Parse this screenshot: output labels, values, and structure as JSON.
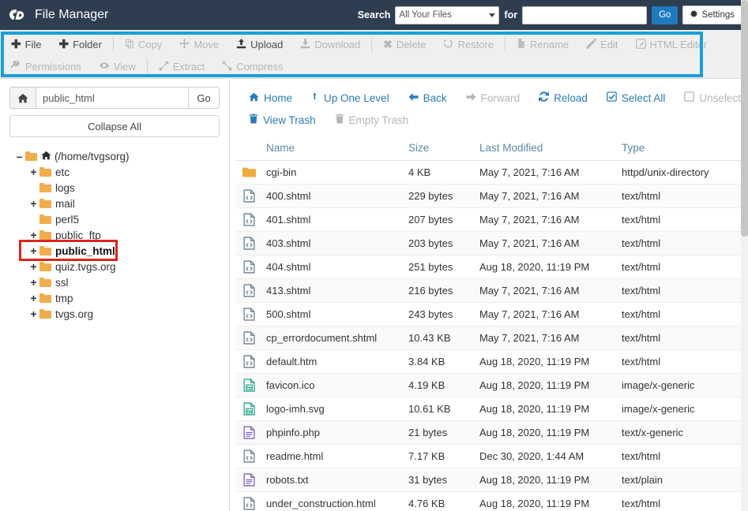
{
  "header": {
    "logo_text": "cP",
    "title": "File Manager",
    "search_label": "Search",
    "search_scope": "All Your Files",
    "for_label": "for",
    "search_value": "",
    "search_placeholder": "",
    "go_label": "Go",
    "settings_label": "Settings",
    "bg_color": "#2e3e50",
    "go_color": "#1e7bbf"
  },
  "toolbar": {
    "highlight_color": "#1a9fda",
    "row1": [
      {
        "label": "File",
        "icon": "plus-icon",
        "disabled": false
      },
      {
        "label": "Folder",
        "icon": "plus-icon",
        "disabled": false
      },
      {
        "label": "Copy",
        "icon": "copy-icon",
        "disabled": true
      },
      {
        "label": "Move",
        "icon": "move-icon",
        "disabled": true
      },
      {
        "label": "Upload",
        "icon": "upload-icon",
        "disabled": false
      },
      {
        "label": "Download",
        "icon": "download-icon",
        "disabled": true
      },
      {
        "label": "Delete",
        "icon": "delete-x-icon",
        "disabled": true
      },
      {
        "label": "Restore",
        "icon": "restore-icon",
        "disabled": true
      },
      {
        "label": "Rename",
        "icon": "rename-icon",
        "disabled": true
      },
      {
        "label": "Edit",
        "icon": "pencil-icon",
        "disabled": true
      },
      {
        "label": "HTML Editor",
        "icon": "html-editor-icon",
        "disabled": true
      }
    ],
    "row2": [
      {
        "label": "Permissions",
        "icon": "key-icon",
        "disabled": true
      },
      {
        "label": "View",
        "icon": "eye-icon",
        "disabled": true
      },
      {
        "label": "Extract",
        "icon": "extract-icon",
        "disabled": true
      },
      {
        "label": "Compress",
        "icon": "compress-icon",
        "disabled": true
      }
    ]
  },
  "sidebar": {
    "home_icon": "home-icon",
    "path_value": "public_html",
    "path_placeholder": "",
    "go_label": "Go",
    "collapse_all_label": "Collapse All",
    "tree": [
      {
        "expander": "minus",
        "label": "(/home/tvgsorg)",
        "indent": 0,
        "home": true,
        "highlight": false
      },
      {
        "expander": "plus",
        "label": "etc",
        "indent": 1,
        "home": false,
        "highlight": false
      },
      {
        "expander": "none",
        "label": "logs",
        "indent": 1,
        "home": false,
        "highlight": false
      },
      {
        "expander": "plus",
        "label": "mail",
        "indent": 1,
        "home": false,
        "highlight": false
      },
      {
        "expander": "none",
        "label": "perl5",
        "indent": 1,
        "home": false,
        "highlight": false
      },
      {
        "expander": "plus",
        "label": "public_ftp",
        "indent": 1,
        "home": false,
        "highlight": false
      },
      {
        "expander": "plus",
        "label": "public_html",
        "indent": 1,
        "home": false,
        "highlight": true
      },
      {
        "expander": "plus",
        "label": "quiz.tvgs.org",
        "indent": 1,
        "home": false,
        "highlight": false
      },
      {
        "expander": "plus",
        "label": "ssl",
        "indent": 1,
        "home": false,
        "highlight": false
      },
      {
        "expander": "plus",
        "label": "tmp",
        "indent": 1,
        "home": false,
        "highlight": false
      },
      {
        "expander": "plus",
        "label": "tvgs.org",
        "indent": 1,
        "home": false,
        "highlight": false
      }
    ],
    "annotation_color": "#d9261c"
  },
  "main": {
    "nav_row1": [
      {
        "label": "Home",
        "icon": "home-icon",
        "disabled": false
      },
      {
        "label": "Up One Level",
        "icon": "up-arrow-icon",
        "disabled": false
      },
      {
        "label": "Back",
        "icon": "arrow-left-icon",
        "disabled": false
      },
      {
        "label": "Forward",
        "icon": "arrow-right-icon",
        "disabled": true
      },
      {
        "label": "Reload",
        "icon": "reload-icon",
        "disabled": false
      },
      {
        "label": "Select All",
        "icon": "checkbox-checked-icon",
        "disabled": false
      },
      {
        "label": "Unselect All",
        "icon": "checkbox-empty-icon",
        "disabled": true
      }
    ],
    "nav_row2": [
      {
        "label": "View Trash",
        "icon": "trash-icon",
        "disabled": false
      },
      {
        "label": "Empty Trash",
        "icon": "trash-icon",
        "disabled": true
      }
    ],
    "columns": [
      "Name",
      "Size",
      "Last Modified",
      "Type"
    ],
    "rows": [
      {
        "icon": "folder-icon",
        "name": "cgi-bin",
        "size": "4 KB",
        "modified": "May 7, 2021, 7:16 AM",
        "type": "httpd/unix-directory"
      },
      {
        "icon": "html-file-icon",
        "name": "400.shtml",
        "size": "229 bytes",
        "modified": "May 7, 2021, 7:16 AM",
        "type": "text/html"
      },
      {
        "icon": "html-file-icon",
        "name": "401.shtml",
        "size": "207 bytes",
        "modified": "May 7, 2021, 7:16 AM",
        "type": "text/html"
      },
      {
        "icon": "html-file-icon",
        "name": "403.shtml",
        "size": "203 bytes",
        "modified": "May 7, 2021, 7:16 AM",
        "type": "text/html"
      },
      {
        "icon": "html-file-icon",
        "name": "404.shtml",
        "size": "251 bytes",
        "modified": "Aug 18, 2020, 11:19 PM",
        "type": "text/html"
      },
      {
        "icon": "html-file-icon",
        "name": "413.shtml",
        "size": "216 bytes",
        "modified": "May 7, 2021, 7:16 AM",
        "type": "text/html"
      },
      {
        "icon": "html-file-icon",
        "name": "500.shtml",
        "size": "243 bytes",
        "modified": "May 7, 2021, 7:16 AM",
        "type": "text/html"
      },
      {
        "icon": "html-file-icon",
        "name": "cp_errordocument.shtml",
        "size": "10.43 KB",
        "modified": "May 7, 2021, 7:16 AM",
        "type": "text/html"
      },
      {
        "icon": "html-file-icon",
        "name": "default.htm",
        "size": "3.84 KB",
        "modified": "Aug 18, 2020, 11:19 PM",
        "type": "text/html"
      },
      {
        "icon": "image-file-icon",
        "name": "favicon.ico",
        "size": "4.19 KB",
        "modified": "Aug 18, 2020, 11:19 PM",
        "type": "image/x-generic"
      },
      {
        "icon": "image-file-icon",
        "name": "logo-imh.svg",
        "size": "10.61 KB",
        "modified": "Aug 18, 2020, 11:19 PM",
        "type": "image/x-generic"
      },
      {
        "icon": "text-file-icon",
        "name": "phpinfo.php",
        "size": "21 bytes",
        "modified": "Aug 18, 2020, 11:19 PM",
        "type": "text/x-generic"
      },
      {
        "icon": "html-file-icon",
        "name": "readme.html",
        "size": "7.17 KB",
        "modified": "Dec 30, 2020, 1:44 AM",
        "type": "text/html"
      },
      {
        "icon": "text-file-icon",
        "name": "robots.txt",
        "size": "31 bytes",
        "modified": "Aug 18, 2020, 11:19 PM",
        "type": "text/plain"
      },
      {
        "icon": "html-file-icon",
        "name": "under_construction.html",
        "size": "4.76 KB",
        "modified": "Aug 18, 2020, 11:19 PM",
        "type": "text/html"
      }
    ]
  }
}
